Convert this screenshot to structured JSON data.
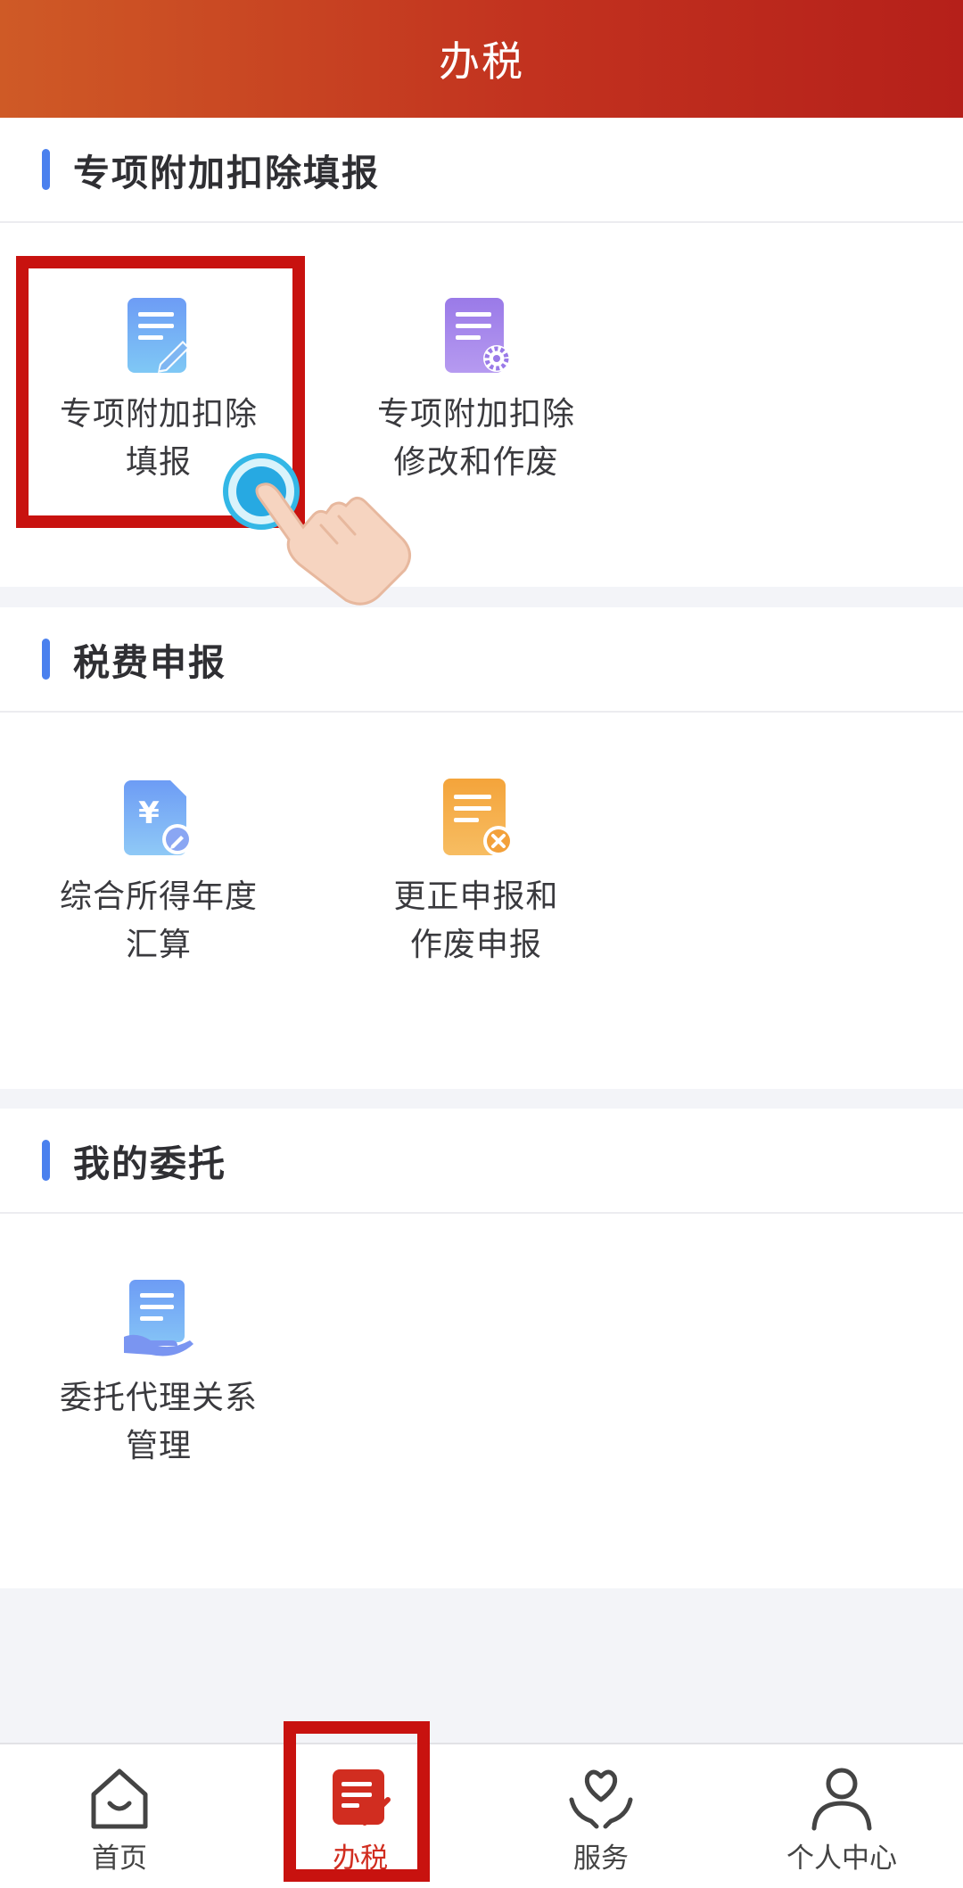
{
  "header": {
    "title": "办税"
  },
  "sections": [
    {
      "title": "专项附加扣除填报",
      "items": [
        {
          "line1": "专项附加扣除",
          "line2": "填报",
          "icon": "doc-edit-icon"
        },
        {
          "line1": "专项附加扣除",
          "line2": "修改和作废",
          "icon": "doc-settings-icon"
        }
      ]
    },
    {
      "title": "税费申报",
      "items": [
        {
          "line1": "综合所得年度",
          "line2": "汇算",
          "icon": "yuan-doc-icon"
        },
        {
          "line1": "更正申报和",
          "line2": "作废申报",
          "icon": "doc-cancel-icon"
        }
      ]
    },
    {
      "title": "我的委托",
      "items": [
        {
          "line1": "委托代理关系",
          "line2": "管理",
          "icon": "doc-hand-icon"
        }
      ]
    }
  ],
  "tabbar": {
    "items": [
      {
        "label": "首页",
        "icon": "home-icon"
      },
      {
        "label": "办税",
        "icon": "tax-doc-icon",
        "active": true
      },
      {
        "label": "服务",
        "icon": "heart-hands-icon"
      },
      {
        "label": "个人中心",
        "icon": "person-icon"
      }
    ]
  },
  "colors": {
    "header_start": "#cf5a26",
    "header_end": "#b5201a",
    "accent_blue": "#4a80ee",
    "highlight_red": "#c8120f",
    "active_tab": "#d12d20"
  }
}
